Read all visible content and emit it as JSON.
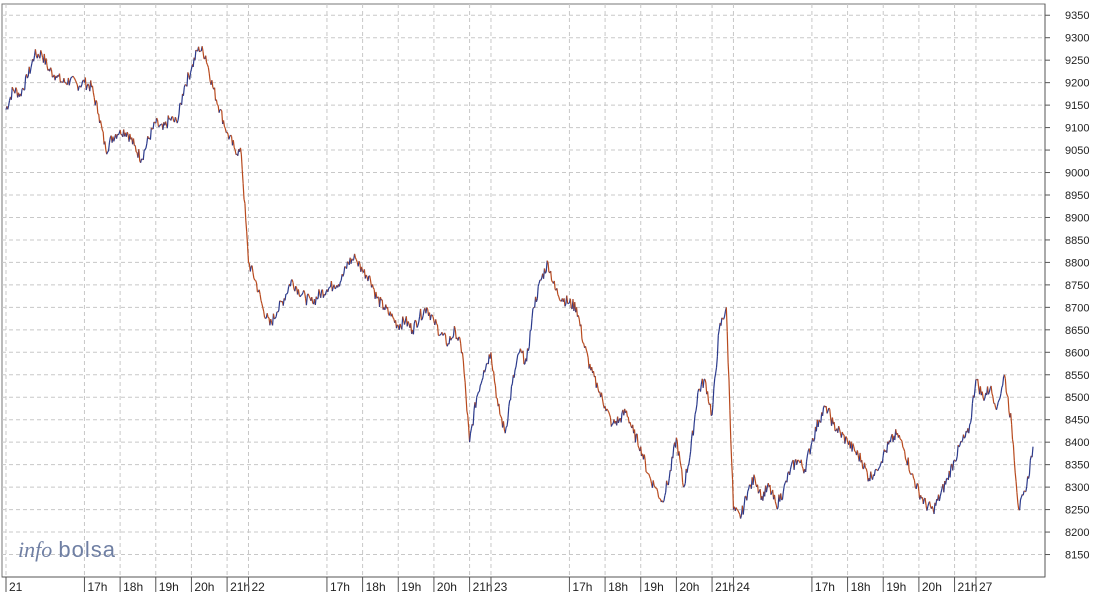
{
  "brand": {
    "pre": "info",
    "post": "bolsa"
  },
  "chart_data": {
    "type": "line",
    "title": "",
    "xlabel": "",
    "ylabel": "",
    "ylim": [
      8100,
      9375
    ],
    "y_ticks": [
      8150,
      8200,
      8250,
      8300,
      8350,
      8400,
      8450,
      8500,
      8550,
      8600,
      8650,
      8700,
      8750,
      8800,
      8850,
      8900,
      8950,
      9000,
      9050,
      9100,
      9150,
      9200,
      9250,
      9300,
      9350
    ],
    "grid": true,
    "x_ticks": [
      {
        "label": "21",
        "day": true,
        "x": 0.0
      },
      {
        "label": "17h",
        "x": 2.2
      },
      {
        "label": "18h",
        "x": 3.2
      },
      {
        "label": "19h",
        "x": 4.2
      },
      {
        "label": "20h",
        "x": 5.2
      },
      {
        "label": "21h",
        "x": 6.2
      },
      {
        "label": "22",
        "day": true,
        "x": 6.8
      },
      {
        "label": "17h",
        "x": 9.0
      },
      {
        "label": "18h",
        "x": 10.0
      },
      {
        "label": "19h",
        "x": 11.0
      },
      {
        "label": "20h",
        "x": 12.0
      },
      {
        "label": "21h",
        "x": 13.0
      },
      {
        "label": "23",
        "day": true,
        "x": 13.6
      },
      {
        "label": "17h",
        "x": 15.8
      },
      {
        "label": "18h",
        "x": 16.8
      },
      {
        "label": "19h",
        "x": 17.8
      },
      {
        "label": "20h",
        "x": 18.8
      },
      {
        "label": "21h",
        "x": 19.8
      },
      {
        "label": "24",
        "day": true,
        "x": 20.4
      },
      {
        "label": "17h",
        "x": 22.6
      },
      {
        "label": "18h",
        "x": 23.6
      },
      {
        "label": "19h",
        "x": 24.6
      },
      {
        "label": "20h",
        "x": 25.6
      },
      {
        "label": "21h",
        "x": 26.6
      },
      {
        "label": "27",
        "day": true,
        "x": 27.2
      }
    ],
    "xlim": [
      0,
      28.8
    ],
    "series": [
      {
        "color_up": "#2b3a8c",
        "color_down": "#b84a1e",
        "points": [
          [
            0.0,
            9140
          ],
          [
            0.2,
            9185
          ],
          [
            0.4,
            9175
          ],
          [
            0.6,
            9210
          ],
          [
            0.8,
            9260
          ],
          [
            1.0,
            9265
          ],
          [
            1.2,
            9230
          ],
          [
            1.4,
            9215
          ],
          [
            1.6,
            9200
          ],
          [
            1.8,
            9205
          ],
          [
            2.0,
            9195
          ],
          [
            2.2,
            9200
          ],
          [
            2.4,
            9190
          ],
          [
            2.6,
            9130
          ],
          [
            2.8,
            9050
          ],
          [
            3.0,
            9080
          ],
          [
            3.2,
            9095
          ],
          [
            3.4,
            9090
          ],
          [
            3.6,
            9060
          ],
          [
            3.8,
            9030
          ],
          [
            4.0,
            9075
          ],
          [
            4.2,
            9110
          ],
          [
            4.4,
            9095
          ],
          [
            4.6,
            9120
          ],
          [
            4.8,
            9110
          ],
          [
            5.0,
            9190
          ],
          [
            5.2,
            9230
          ],
          [
            5.4,
            9280
          ],
          [
            5.6,
            9260
          ],
          [
            5.8,
            9190
          ],
          [
            6.0,
            9140
          ],
          [
            6.2,
            9090
          ],
          [
            6.4,
            9055
          ],
          [
            6.6,
            9040
          ],
          [
            6.8,
            8800
          ],
          [
            7.0,
            8760
          ],
          [
            7.2,
            8700
          ],
          [
            7.4,
            8660
          ],
          [
            7.6,
            8690
          ],
          [
            7.8,
            8720
          ],
          [
            8.0,
            8760
          ],
          [
            8.2,
            8740
          ],
          [
            8.4,
            8720
          ],
          [
            8.6,
            8710
          ],
          [
            8.8,
            8730
          ],
          [
            9.0,
            8740
          ],
          [
            9.2,
            8750
          ],
          [
            9.4,
            8760
          ],
          [
            9.6,
            8800
          ],
          [
            9.8,
            8810
          ],
          [
            10.0,
            8780
          ],
          [
            10.2,
            8770
          ],
          [
            10.4,
            8720
          ],
          [
            10.6,
            8700
          ],
          [
            10.8,
            8680
          ],
          [
            11.0,
            8660
          ],
          [
            11.2,
            8670
          ],
          [
            11.4,
            8650
          ],
          [
            11.6,
            8680
          ],
          [
            11.8,
            8700
          ],
          [
            12.0,
            8670
          ],
          [
            12.2,
            8640
          ],
          [
            12.4,
            8620
          ],
          [
            12.6,
            8650
          ],
          [
            12.8,
            8600
          ],
          [
            13.0,
            8400
          ],
          [
            13.2,
            8500
          ],
          [
            13.4,
            8560
          ],
          [
            13.6,
            8600
          ],
          [
            13.8,
            8480
          ],
          [
            14.0,
            8420
          ],
          [
            14.2,
            8530
          ],
          [
            14.4,
            8600
          ],
          [
            14.6,
            8580
          ],
          [
            14.8,
            8700
          ],
          [
            15.0,
            8760
          ],
          [
            15.2,
            8800
          ],
          [
            15.4,
            8740
          ],
          [
            15.6,
            8720
          ],
          [
            15.8,
            8710
          ],
          [
            16.0,
            8700
          ],
          [
            16.2,
            8620
          ],
          [
            16.4,
            8560
          ],
          [
            16.6,
            8520
          ],
          [
            16.8,
            8480
          ],
          [
            17.0,
            8440
          ],
          [
            17.2,
            8450
          ],
          [
            17.4,
            8470
          ],
          [
            17.6,
            8420
          ],
          [
            17.8,
            8390
          ],
          [
            18.0,
            8330
          ],
          [
            18.2,
            8300
          ],
          [
            18.4,
            8270
          ],
          [
            18.6,
            8320
          ],
          [
            18.8,
            8410
          ],
          [
            19.0,
            8300
          ],
          [
            19.2,
            8380
          ],
          [
            19.4,
            8510
          ],
          [
            19.6,
            8540
          ],
          [
            19.8,
            8460
          ],
          [
            20.0,
            8650
          ],
          [
            20.2,
            8700
          ],
          [
            20.4,
            8250
          ],
          [
            20.6,
            8230
          ],
          [
            20.8,
            8290
          ],
          [
            21.0,
            8320
          ],
          [
            21.2,
            8280
          ],
          [
            21.4,
            8300
          ],
          [
            21.6,
            8260
          ],
          [
            21.8,
            8290
          ],
          [
            22.0,
            8340
          ],
          [
            22.2,
            8360
          ],
          [
            22.4,
            8340
          ],
          [
            22.6,
            8400
          ],
          [
            22.8,
            8450
          ],
          [
            23.0,
            8480
          ],
          [
            23.2,
            8440
          ],
          [
            23.4,
            8420
          ],
          [
            23.6,
            8400
          ],
          [
            23.8,
            8380
          ],
          [
            24.0,
            8360
          ],
          [
            24.2,
            8320
          ],
          [
            24.4,
            8340
          ],
          [
            24.6,
            8370
          ],
          [
            24.8,
            8400
          ],
          [
            25.0,
            8420
          ],
          [
            25.2,
            8380
          ],
          [
            25.4,
            8330
          ],
          [
            25.6,
            8290
          ],
          [
            25.8,
            8260
          ],
          [
            26.0,
            8250
          ],
          [
            26.2,
            8280
          ],
          [
            26.4,
            8320
          ],
          [
            26.6,
            8360
          ],
          [
            26.8,
            8400
          ],
          [
            27.0,
            8420
          ],
          [
            27.2,
            8540
          ],
          [
            27.4,
            8500
          ],
          [
            27.6,
            8520
          ],
          [
            27.8,
            8480
          ],
          [
            28.0,
            8550
          ],
          [
            28.2,
            8440
          ],
          [
            28.4,
            8250
          ],
          [
            28.6,
            8290
          ],
          [
            28.8,
            8390
          ]
        ]
      }
    ]
  }
}
